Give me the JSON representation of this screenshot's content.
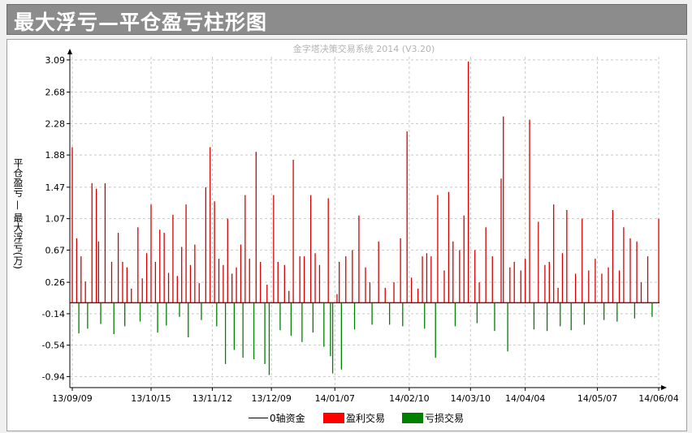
{
  "window_title": "最大浮亏—平仓盈亏柱形图",
  "watermark": "金字塔决策交易系统 2014 (V3.20)",
  "colors": {
    "profit": "#d40000",
    "loss": "#007f00",
    "zero_line": "#7a1414",
    "grid": "#c8c8c8"
  },
  "chart_data": {
    "type": "bar",
    "title": "",
    "xlabel": "",
    "ylabel": "平仓盈亏 — 最大浮亏(万)",
    "yticks": [
      "3.09",
      "2.68",
      "2.28",
      "1.88",
      "1.47",
      "1.07",
      "0.67",
      "0.26",
      "-0.14",
      "-0.54",
      "-0.94"
    ],
    "ylim": [
      -1.08,
      3.13
    ],
    "xticks": [
      "13/09/09",
      "13/10/15",
      "13/11/12",
      "13/12/09",
      "14/01/07",
      "14/02/10",
      "14/03/10",
      "14/04/04",
      "14/05/07",
      "14/06/04"
    ],
    "x_start": "2013-09-09",
    "x_end": "2014-06-04",
    "grid": true,
    "legend": [
      {
        "label": "0轴资金",
        "kind": "line"
      },
      {
        "label": "盈利交易",
        "kind": "fill"
      },
      {
        "label": "亏损交易",
        "kind": "fill"
      }
    ],
    "series": [
      {
        "name": "盈利交易",
        "points": [
          [
            "2013-09-09",
            1.98
          ],
          [
            "2013-09-11",
            0.82
          ],
          [
            "2013-09-13",
            0.59
          ],
          [
            "2013-09-15",
            0.27
          ],
          [
            "2013-09-18",
            1.52
          ],
          [
            "2013-09-20",
            1.45
          ],
          [
            "2013-09-21",
            0.78
          ],
          [
            "2013-09-24",
            1.52
          ],
          [
            "2013-09-27",
            0.52
          ],
          [
            "2013-09-30",
            0.89
          ],
          [
            "2013-10-02",
            0.52
          ],
          [
            "2013-10-04",
            0.45
          ],
          [
            "2013-10-06",
            0.18
          ],
          [
            "2013-10-09",
            0.96
          ],
          [
            "2013-10-11",
            0.31
          ],
          [
            "2013-10-13",
            0.63
          ],
          [
            "2013-10-15",
            1.25
          ],
          [
            "2013-10-17",
            0.52
          ],
          [
            "2013-10-19",
            0.93
          ],
          [
            "2013-10-21",
            0.89
          ],
          [
            "2013-10-23",
            0.38
          ],
          [
            "2013-10-25",
            1.12
          ],
          [
            "2013-10-27",
            0.34
          ],
          [
            "2013-10-29",
            0.71
          ],
          [
            "2013-10-31",
            1.25
          ],
          [
            "2013-11-02",
            0.48
          ],
          [
            "2013-11-04",
            0.74
          ],
          [
            "2013-11-06",
            0.25
          ],
          [
            "2013-11-09",
            1.47
          ],
          [
            "2013-11-11",
            1.98
          ],
          [
            "2013-11-13",
            1.29
          ],
          [
            "2013-11-15",
            0.56
          ],
          [
            "2013-11-17",
            0.48
          ],
          [
            "2013-11-19",
            1.07
          ],
          [
            "2013-11-21",
            0.37
          ],
          [
            "2013-11-23",
            0.45
          ],
          [
            "2013-11-25",
            0.74
          ],
          [
            "2013-11-27",
            1.37
          ],
          [
            "2013-11-29",
            0.56
          ],
          [
            "2013-12-02",
            1.92
          ],
          [
            "2013-12-04",
            0.52
          ],
          [
            "2013-12-07",
            0.23
          ],
          [
            "2013-12-10",
            1.37
          ],
          [
            "2013-12-12",
            0.52
          ],
          [
            "2013-12-15",
            0.48
          ],
          [
            "2013-12-17",
            0.15
          ],
          [
            "2013-12-19",
            1.82
          ],
          [
            "2013-12-22",
            0.59
          ],
          [
            "2013-12-24",
            0.59
          ],
          [
            "2013-12-27",
            1.37
          ],
          [
            "2013-12-29",
            0.63
          ],
          [
            "2013-12-31",
            0.48
          ],
          [
            "2014-01-04",
            1.33
          ],
          [
            "2014-01-08",
            0.11
          ],
          [
            "2014-01-09",
            0.52
          ],
          [
            "2014-01-12",
            0.59
          ],
          [
            "2014-01-15",
            0.67
          ],
          [
            "2014-01-18",
            1.11
          ],
          [
            "2014-01-21",
            0.45
          ],
          [
            "2014-01-23",
            0.26
          ],
          [
            "2014-01-27",
            0.78
          ],
          [
            "2014-01-30",
            0.19
          ],
          [
            "2014-02-03",
            0.26
          ],
          [
            "2014-02-06",
            0.82
          ],
          [
            "2014-02-09",
            2.18
          ],
          [
            "2014-02-11",
            0.32
          ],
          [
            "2014-02-14",
            0.18
          ],
          [
            "2014-02-16",
            0.59
          ],
          [
            "2014-02-18",
            0.63
          ],
          [
            "2014-02-20",
            0.59
          ],
          [
            "2014-02-23",
            1.37
          ],
          [
            "2014-02-26",
            0.41
          ],
          [
            "2014-02-28",
            1.41
          ],
          [
            "2014-03-02",
            0.78
          ],
          [
            "2014-03-05",
            0.67
          ],
          [
            "2014-03-07",
            1.11
          ],
          [
            "2014-03-09",
            3.07
          ],
          [
            "2014-03-12",
            0.67
          ],
          [
            "2014-03-14",
            0.26
          ],
          [
            "2014-03-17",
            0.96
          ],
          [
            "2014-03-20",
            0.59
          ],
          [
            "2014-03-24",
            1.58
          ],
          [
            "2014-03-25",
            2.37
          ],
          [
            "2014-03-28",
            0.45
          ],
          [
            "2014-03-30",
            0.52
          ],
          [
            "2014-04-02",
            0.41
          ],
          [
            "2014-04-04",
            0.56
          ],
          [
            "2014-04-06",
            2.33
          ],
          [
            "2014-04-10",
            1.03
          ],
          [
            "2014-04-13",
            0.48
          ],
          [
            "2014-04-15",
            0.52
          ],
          [
            "2014-04-17",
            1.25
          ],
          [
            "2014-04-19",
            0.19
          ],
          [
            "2014-04-21",
            0.63
          ],
          [
            "2014-04-23",
            1.18
          ],
          [
            "2014-04-27",
            0.37
          ],
          [
            "2014-04-30",
            1.07
          ],
          [
            "2014-05-03",
            0.41
          ],
          [
            "2014-05-06",
            0.56
          ],
          [
            "2014-05-09",
            0.37
          ],
          [
            "2014-05-12",
            0.45
          ],
          [
            "2014-05-14",
            1.18
          ],
          [
            "2014-05-17",
            0.41
          ],
          [
            "2014-05-19",
            0.96
          ],
          [
            "2014-05-22",
            0.82
          ],
          [
            "2014-05-25",
            0.78
          ],
          [
            "2014-05-27",
            0.26
          ],
          [
            "2014-05-30",
            0.59
          ],
          [
            "2014-06-04",
            1.07
          ]
        ]
      },
      {
        "name": "亏损交易",
        "points": [
          [
            "2013-09-12",
            -0.39
          ],
          [
            "2013-09-16",
            -0.33
          ],
          [
            "2013-09-22",
            -0.27
          ],
          [
            "2013-09-28",
            -0.4
          ],
          [
            "2013-10-03",
            -0.3
          ],
          [
            "2013-10-10",
            -0.24
          ],
          [
            "2013-10-18",
            -0.38
          ],
          [
            "2013-10-22",
            -0.29
          ],
          [
            "2013-10-28",
            -0.18
          ],
          [
            "2013-11-01",
            -0.44
          ],
          [
            "2013-11-07",
            -0.22
          ],
          [
            "2013-11-14",
            -0.3
          ],
          [
            "2013-11-18",
            -0.78
          ],
          [
            "2013-11-22",
            -0.6
          ],
          [
            "2013-11-26",
            -0.7
          ],
          [
            "2013-12-01",
            -0.72
          ],
          [
            "2013-12-06",
            -0.78
          ],
          [
            "2013-12-08",
            -0.92
          ],
          [
            "2013-12-13",
            -0.35
          ],
          [
            "2013-12-18",
            -0.42
          ],
          [
            "2013-12-23",
            -0.5
          ],
          [
            "2013-12-28",
            -0.38
          ],
          [
            "2014-01-02",
            -0.56
          ],
          [
            "2014-01-05",
            -0.68
          ],
          [
            "2014-01-06",
            -0.9
          ],
          [
            "2014-01-10",
            -0.85
          ],
          [
            "2014-01-16",
            -0.34
          ],
          [
            "2014-01-24",
            -0.28
          ],
          [
            "2014-02-01",
            -0.28
          ],
          [
            "2014-02-07",
            -0.3
          ],
          [
            "2014-02-17",
            -0.33
          ],
          [
            "2014-02-22",
            -0.7
          ],
          [
            "2014-03-03",
            -0.3
          ],
          [
            "2014-03-13",
            -0.26
          ],
          [
            "2014-03-21",
            -0.36
          ],
          [
            "2014-03-27",
            -0.62
          ],
          [
            "2014-04-08",
            -0.34
          ],
          [
            "2014-04-14",
            -0.36
          ],
          [
            "2014-04-20",
            -0.3
          ],
          [
            "2014-04-25",
            -0.35
          ],
          [
            "2014-05-01",
            -0.28
          ],
          [
            "2014-05-10",
            -0.22
          ],
          [
            "2014-05-16",
            -0.24
          ],
          [
            "2014-05-24",
            -0.2
          ],
          [
            "2014-06-01",
            -0.18
          ]
        ]
      }
    ]
  }
}
